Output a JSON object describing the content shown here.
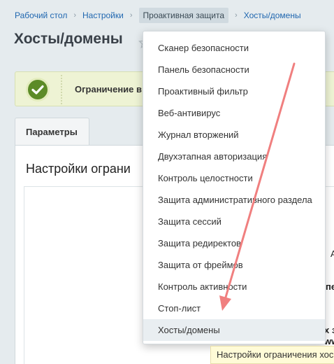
{
  "breadcrumb": {
    "items": [
      "Рабочий стол",
      "Настройки",
      "Проактивная защита",
      "Хосты/домены"
    ],
    "separator": "›"
  },
  "page": {
    "title": "Хосты/домены"
  },
  "notice": {
    "text": "Ограничение в"
  },
  "tabs": [
    {
      "label": "Параметры"
    }
  ],
  "panel": {
    "title": "Настройки ограни",
    "side_fragments": [
      "А",
      "пе",
      "х з",
      "ww"
    ]
  },
  "menu": {
    "items": [
      "Сканер безопасности",
      "Панель безопасности",
      "Проактивный фильтр",
      "Веб-антивирус",
      "Журнал вторжений",
      "Двухэтапная авторизация",
      "Контроль целостности",
      "Защита административного раздела",
      "Защита сессий",
      "Защита редиректов",
      "Защита от фреймов",
      "Контроль активности",
      "Стоп-лист",
      "Хосты/домены"
    ],
    "selected_index": 13
  },
  "tooltip": {
    "text": "Настройки ограничения хос"
  },
  "colors": {
    "background": "#e5ebee",
    "link": "#2067b0",
    "notice_bg": "#eef3d4",
    "check": "#5c8b27",
    "annotation_arrow": "#f07f7f",
    "tooltip_bg": "#fffbd7"
  },
  "icons": {
    "notice": "check-circle-icon",
    "favorite": "star-icon",
    "annotation": "red-arrow-annotation"
  }
}
